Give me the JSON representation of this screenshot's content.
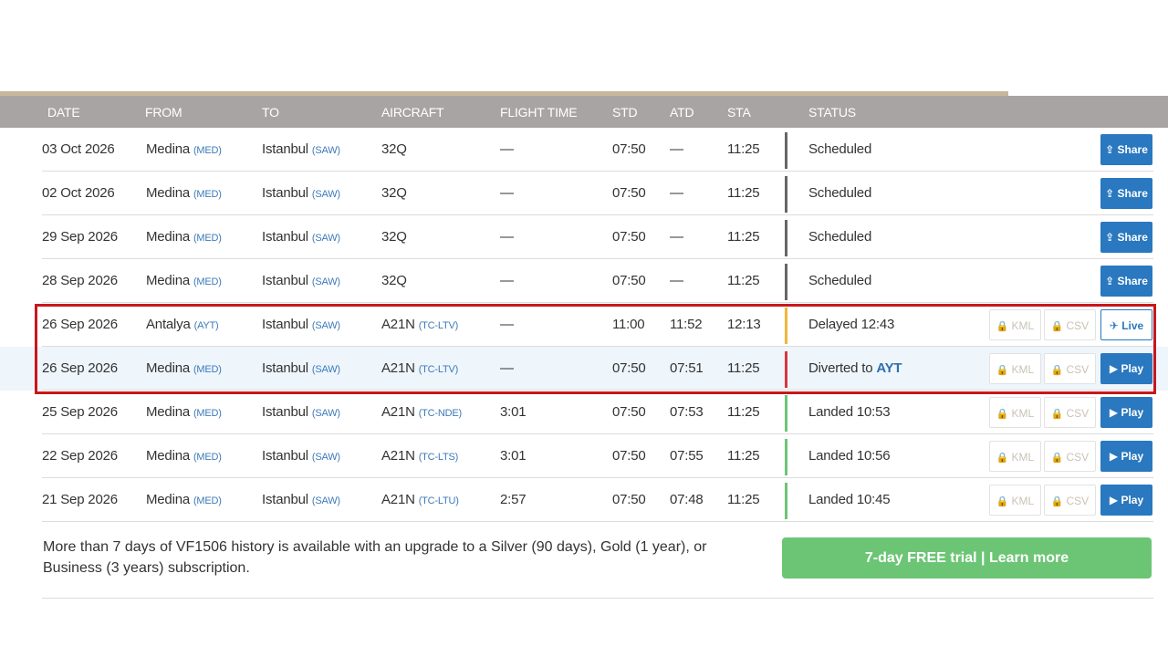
{
  "header": {
    "columns": [
      "DATE",
      "FROM",
      "TO",
      "AIRCRAFT",
      "FLIGHT TIME",
      "STD",
      "ATD",
      "STA",
      "STATUS"
    ]
  },
  "rows": [
    {
      "date": "03 Oct 2026",
      "from": "Medina",
      "from_code": "(MED)",
      "to": "Istanbul",
      "to_code": "(SAW)",
      "aircraft": "32Q",
      "aircraft_reg": "",
      "flight_time": "—",
      "std": "07:50",
      "atd": "—",
      "sta": "11:25",
      "status": "Scheduled",
      "status_code": "",
      "status_color": "#666666",
      "actions": [
        "Share"
      ]
    },
    {
      "date": "02 Oct 2026",
      "from": "Medina",
      "from_code": "(MED)",
      "to": "Istanbul",
      "to_code": "(SAW)",
      "aircraft": "32Q",
      "aircraft_reg": "",
      "flight_time": "—",
      "std": "07:50",
      "atd": "—",
      "sta": "11:25",
      "status": "Scheduled",
      "status_code": "",
      "status_color": "#666666",
      "actions": [
        "Share"
      ]
    },
    {
      "date": "29 Sep 2026",
      "from": "Medina",
      "from_code": "(MED)",
      "to": "Istanbul",
      "to_code": "(SAW)",
      "aircraft": "32Q",
      "aircraft_reg": "",
      "flight_time": "—",
      "std": "07:50",
      "atd": "—",
      "sta": "11:25",
      "status": "Scheduled",
      "status_code": "",
      "status_color": "#666666",
      "actions": [
        "Share"
      ]
    },
    {
      "date": "28 Sep 2026",
      "from": "Medina",
      "from_code": "(MED)",
      "to": "Istanbul",
      "to_code": "(SAW)",
      "aircraft": "32Q",
      "aircraft_reg": "",
      "flight_time": "—",
      "std": "07:50",
      "atd": "—",
      "sta": "11:25",
      "status": "Scheduled",
      "status_code": "",
      "status_color": "#666666",
      "actions": [
        "Share"
      ]
    },
    {
      "date": "26 Sep 2026",
      "from": "Antalya",
      "from_code": "(AYT)",
      "to": "Istanbul",
      "to_code": "(SAW)",
      "aircraft": "A21N",
      "aircraft_reg": "(TC-LTV)",
      "flight_time": "—",
      "std": "11:00",
      "atd": "11:52",
      "sta": "12:13",
      "status": "Delayed 12:43",
      "status_code": "",
      "status_color": "#f0b73a",
      "actions": [
        "KML",
        "CSV",
        "Live"
      ]
    },
    {
      "date": "26 Sep 2026",
      "from": "Medina",
      "from_code": "(MED)",
      "to": "Istanbul",
      "to_code": "(SAW)",
      "aircraft": "A21N",
      "aircraft_reg": "(TC-LTV)",
      "flight_time": "—",
      "std": "07:50",
      "atd": "07:51",
      "sta": "11:25",
      "status": "Diverted to",
      "status_code": "AYT",
      "status_color": "#d9363e",
      "actions": [
        "KML",
        "CSV",
        "Play"
      ],
      "highlight": true
    },
    {
      "date": "25 Sep 2026",
      "from": "Medina",
      "from_code": "(MED)",
      "to": "Istanbul",
      "to_code": "(SAW)",
      "aircraft": "A21N",
      "aircraft_reg": "(TC-NDE)",
      "flight_time": "3:01",
      "std": "07:50",
      "atd": "07:53",
      "sta": "11:25",
      "status": "Landed 10:53",
      "status_code": "",
      "status_color": "#6cc575",
      "actions": [
        "KML",
        "CSV",
        "Play"
      ]
    },
    {
      "date": "22 Sep 2026",
      "from": "Medina",
      "from_code": "(MED)",
      "to": "Istanbul",
      "to_code": "(SAW)",
      "aircraft": "A21N",
      "aircraft_reg": "(TC-LTS)",
      "flight_time": "3:01",
      "std": "07:50",
      "atd": "07:55",
      "sta": "11:25",
      "status": "Landed 10:56",
      "status_code": "",
      "status_color": "#6cc575",
      "actions": [
        "KML",
        "CSV",
        "Play"
      ]
    },
    {
      "date": "21 Sep 2026",
      "from": "Medina",
      "from_code": "(MED)",
      "to": "Istanbul",
      "to_code": "(SAW)",
      "aircraft": "A21N",
      "aircraft_reg": "(TC-LTU)",
      "flight_time": "2:57",
      "std": "07:50",
      "atd": "07:48",
      "sta": "11:25",
      "status": "Landed 10:45",
      "status_code": "",
      "status_color": "#6cc575",
      "actions": [
        "KML",
        "CSV",
        "Play"
      ]
    }
  ],
  "footer": {
    "message": "More than 7 days of VF1506 history is available with an upgrade to a Silver (90 days), Gold (1 year), or Business (3 years) subscription.",
    "trial_button": "7-day FREE trial | Learn more"
  },
  "icons": {
    "share": "share-icon",
    "live": "plane-icon",
    "play": "play-icon",
    "lock": "lock-icon"
  },
  "colors": {
    "header_bg": "#a9a4a4",
    "action_blue": "#2a78bf",
    "trial_green": "#6cc575",
    "highlight_box": "#c8171c"
  }
}
